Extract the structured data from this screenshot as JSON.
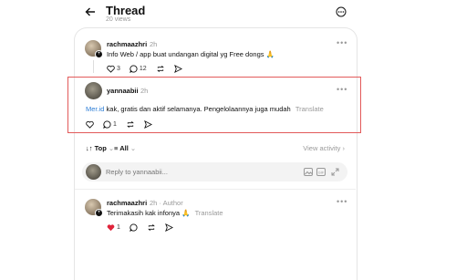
{
  "header": {
    "title": "Thread",
    "views": "20 views"
  },
  "post1": {
    "username": "rachmaazhri",
    "time": "2h",
    "text": "Info Web / app buat undangan digital yg Free dongs",
    "emoji": "🙏",
    "likes": "3",
    "replies": "12"
  },
  "post2": {
    "username": "yannaabii",
    "time": "2h",
    "link": "Mer.id",
    "text": " kak, gratis dan aktif selamanya. Pengelolaannya juga mudah",
    "translate": "Translate",
    "replies": "1"
  },
  "sort": {
    "top": "Top",
    "all": "All",
    "view_activity": "View activity"
  },
  "reply": {
    "placeholder": "Reply to yannaabii..."
  },
  "post3": {
    "username": "rachmaazhri",
    "time": "2h",
    "author": "Author",
    "text": "Terimakasih kak infonya",
    "emoji": "🙏",
    "translate": "Translate",
    "likes": "1"
  },
  "colors": {
    "accent_link": "#2f7fd6",
    "like_red": "#e0243b",
    "highlight": "#e25a5a"
  }
}
